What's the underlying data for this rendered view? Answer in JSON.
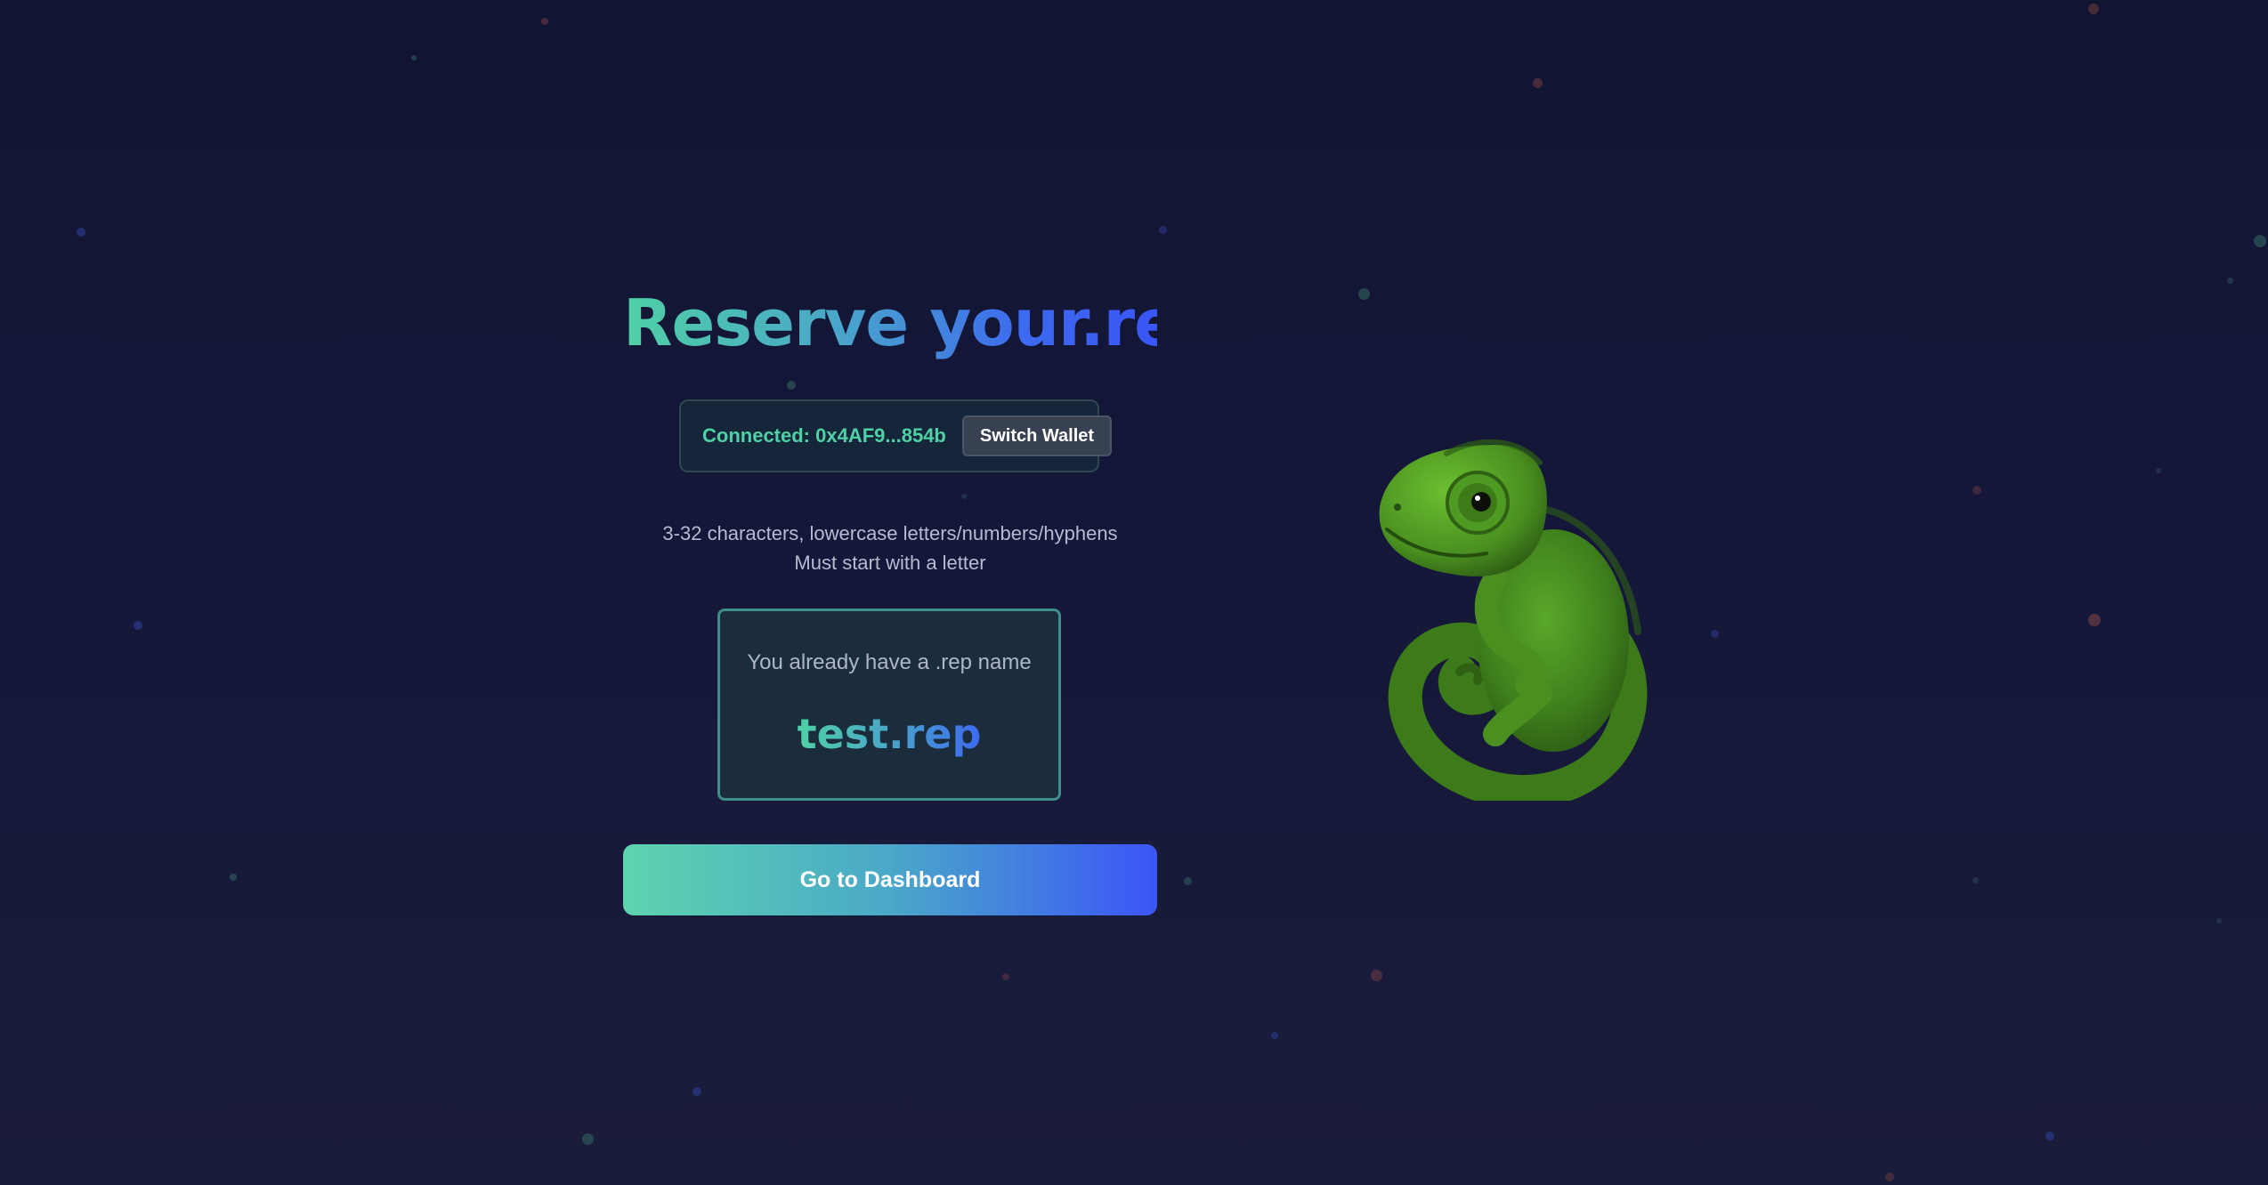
{
  "page": {
    "title_part1": "Reserve ",
    "title_part2": "your.rep"
  },
  "wallet": {
    "status": "Connected: 0x4AF9...854b",
    "switch_label": "Switch Wallet"
  },
  "rules": {
    "line1": "3-32 characters, lowercase letters/numbers/hyphens",
    "line2": "Must start with a letter"
  },
  "owned": {
    "label": "You already have a .rep name",
    "name": "test.rep"
  },
  "cta": {
    "label": "Go to Dashboard"
  },
  "mascot": {
    "icon": "chameleon-icon"
  },
  "colors": {
    "accent_green": "#4fd1a5",
    "accent_blue": "#3b55f7",
    "background": "#15173a"
  }
}
